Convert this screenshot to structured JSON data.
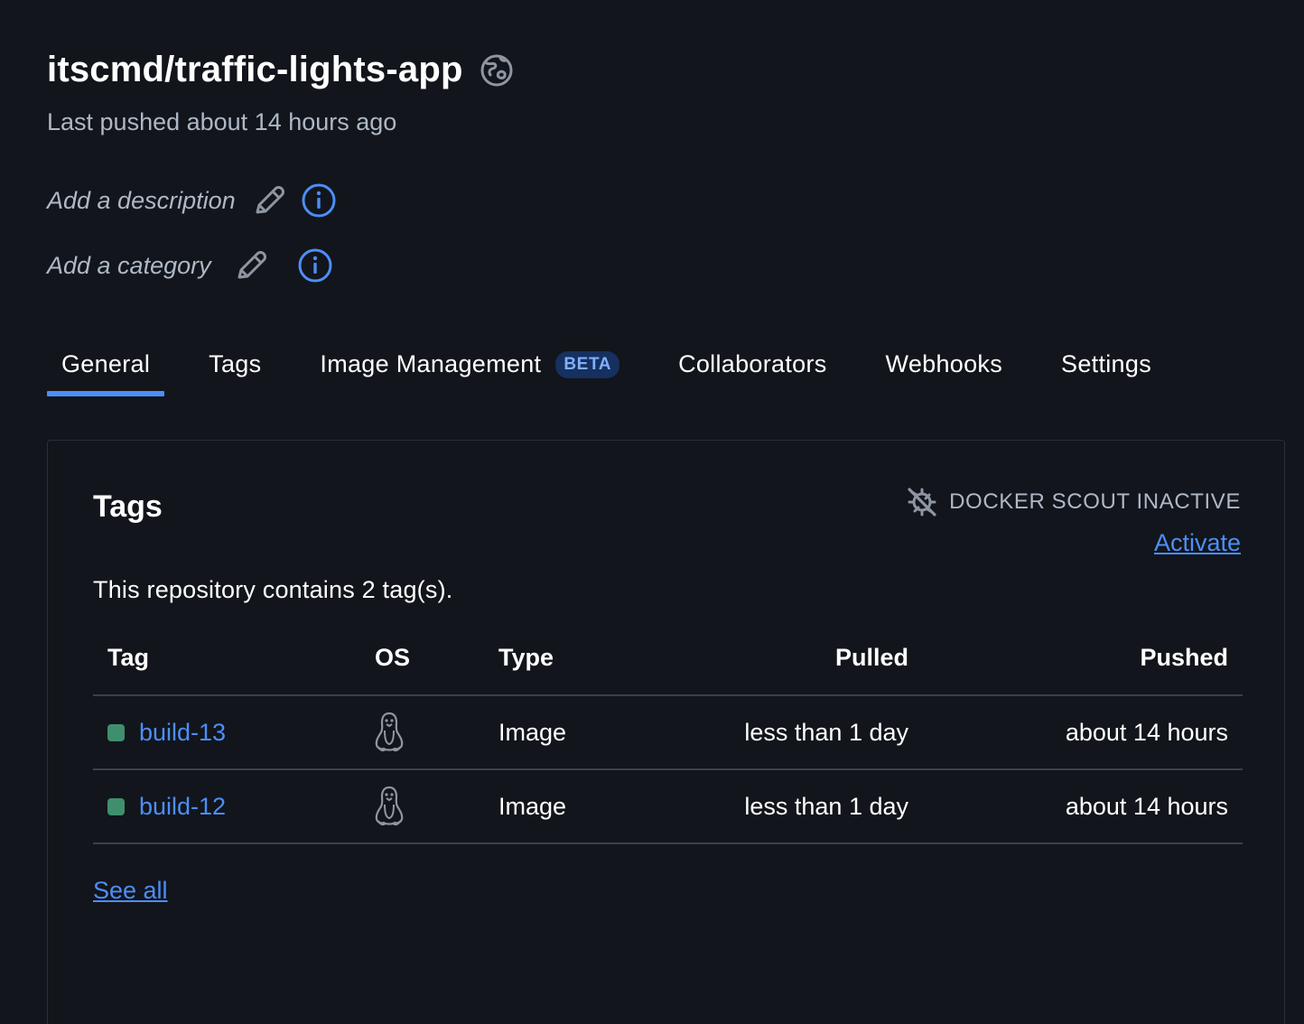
{
  "repo": {
    "title": "itscmd/traffic-lights-app",
    "last_pushed": "Last pushed about 14 hours ago",
    "visibility_icon": "globe-icon",
    "description_placeholder": "Add a description",
    "category_placeholder": "Add a category"
  },
  "tabs": [
    {
      "label": "General",
      "active": true
    },
    {
      "label": "Tags"
    },
    {
      "label": "Image Management",
      "badge": "BETA"
    },
    {
      "label": "Collaborators"
    },
    {
      "label": "Webhooks"
    },
    {
      "label": "Settings"
    }
  ],
  "card": {
    "title": "Tags",
    "scout_status": "DOCKER SCOUT INACTIVE",
    "activate_label": "Activate",
    "repo_count_text": "This repository contains 2 tag(s).",
    "see_all": "See all"
  },
  "table": {
    "headers": {
      "tag": "Tag",
      "os": "OS",
      "type": "Type",
      "pulled": "Pulled",
      "pushed": "Pushed"
    },
    "rows": [
      {
        "tag": "build-13",
        "os_icon": "linux-icon",
        "type": "Image",
        "pulled": "less than 1 day",
        "pushed": "about 14 hours"
      },
      {
        "tag": "build-12",
        "os_icon": "linux-icon",
        "type": "Image",
        "pulled": "less than 1 day",
        "pushed": "about 14 hours"
      }
    ]
  },
  "colors": {
    "background": "#12151b",
    "accent": "#4d8ef7",
    "muted_text": "#aeb8c6",
    "status_green": "#3f8f6e",
    "divider": "#3a404b"
  }
}
